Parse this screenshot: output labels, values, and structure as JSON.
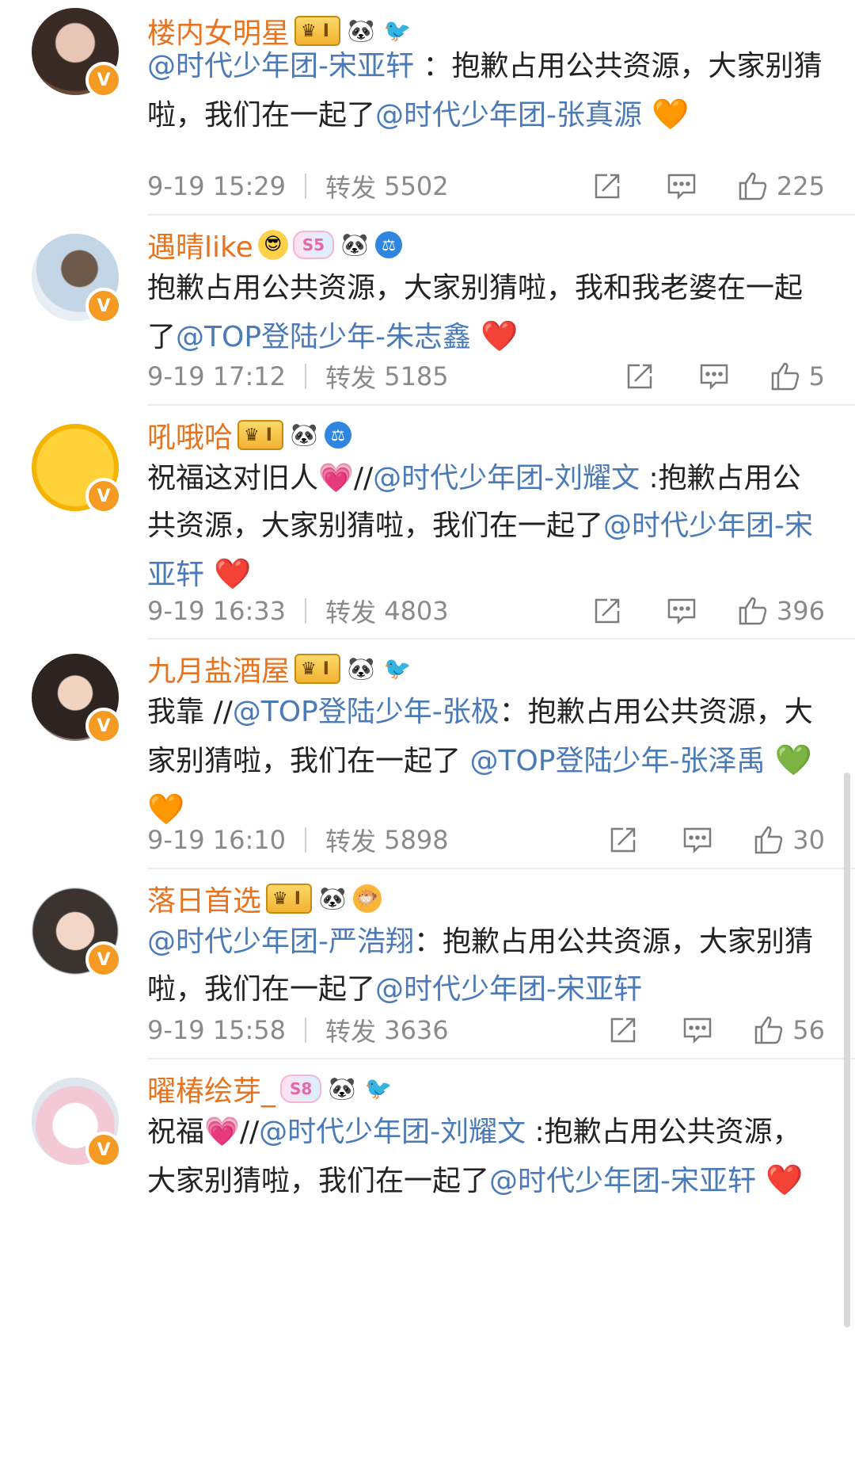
{
  "repost_label": "转发",
  "posts": [
    {
      "username": "楼内女明星",
      "crown_badge": "I",
      "icons": [
        "panda-icon",
        "bird-icon"
      ],
      "segments": [
        {
          "text": "@时代少年团-宋亚轩",
          "mention": true
        },
        {
          "text": " ：抱歉占用公共资源，大家别猜啦，我们在一起了",
          "mention": false
        },
        {
          "text": "@时代少年团-张真源",
          "mention": true
        },
        {
          "text": " 🧡",
          "mention": false
        }
      ],
      "date": "9-19 15:29",
      "reposts": "5502",
      "likes": "225"
    },
    {
      "username": "遇晴like",
      "svip_badge": "S5",
      "icons": [
        "sunglasses-icon",
        "panda-icon",
        "shield-icon"
      ],
      "segments": [
        {
          "text": "抱歉占用公共资源，大家别猜啦，我和我老婆在一起了",
          "mention": false
        },
        {
          "text": "@TOP登陆少年-朱志鑫",
          "mention": true
        },
        {
          "text": " ❤️",
          "mention": false
        }
      ],
      "date": "9-19 17:12",
      "reposts": "5185",
      "likes": "5"
    },
    {
      "username": "吼哦哈",
      "crown_badge": "I",
      "icons": [
        "panda-icon",
        "shield-icon"
      ],
      "segments": [
        {
          "text": "祝福这对旧人💗//",
          "mention": false
        },
        {
          "text": "@时代少年团-刘耀文",
          "mention": true
        },
        {
          "text": " :抱歉占用公共资源，大家别猜啦，我们在一起了",
          "mention": false
        },
        {
          "text": "@时代少年团-宋亚轩",
          "mention": true
        },
        {
          "text": " ❤️",
          "mention": false
        }
      ],
      "date": "9-19 16:33",
      "reposts": "4803",
      "likes": "396"
    },
    {
      "username": "九月盐酒屋",
      "crown_badge": "I",
      "icons": [
        "panda-icon",
        "bird-icon"
      ],
      "segments": [
        {
          "text": "我靠 //",
          "mention": false
        },
        {
          "text": "@TOP登陆少年-张极",
          "mention": true
        },
        {
          "text": "：抱歉占用公共资源，大家别猜啦，我们在一起了 ",
          "mention": false
        },
        {
          "text": "@TOP登陆少年-张泽禹",
          "mention": true
        },
        {
          "text": " 💚🧡",
          "mention": false
        }
      ],
      "date": "9-19 16:10",
      "reposts": "5898",
      "likes": "30"
    },
    {
      "username": "落日首选",
      "crown_badge": "I",
      "icons": [
        "panda-icon",
        "fish-icon"
      ],
      "segments": [
        {
          "text": "@时代少年团-严浩翔",
          "mention": true
        },
        {
          "text": "：抱歉占用公共资源，大家别猜啦，我们在一起了",
          "mention": false
        },
        {
          "text": "@时代少年团-宋亚轩",
          "mention": true
        }
      ],
      "date": "9-19 15:58",
      "reposts": "3636",
      "likes": "56"
    },
    {
      "username": "曜椿绘芽_",
      "svip_badge": "S8",
      "icons": [
        "panda-icon",
        "bird-icon"
      ],
      "segments": [
        {
          "text": "祝福💗//",
          "mention": false
        },
        {
          "text": "@时代少年团-刘耀文",
          "mention": true
        },
        {
          "text": " :抱歉占用公共资源，大家别猜啦，我们在一起了",
          "mention": false
        },
        {
          "text": "@时代少年团-宋亚轩",
          "mention": true
        },
        {
          "text": " ❤️",
          "mention": false
        }
      ],
      "date": "",
      "reposts": "",
      "likes": ""
    }
  ]
}
